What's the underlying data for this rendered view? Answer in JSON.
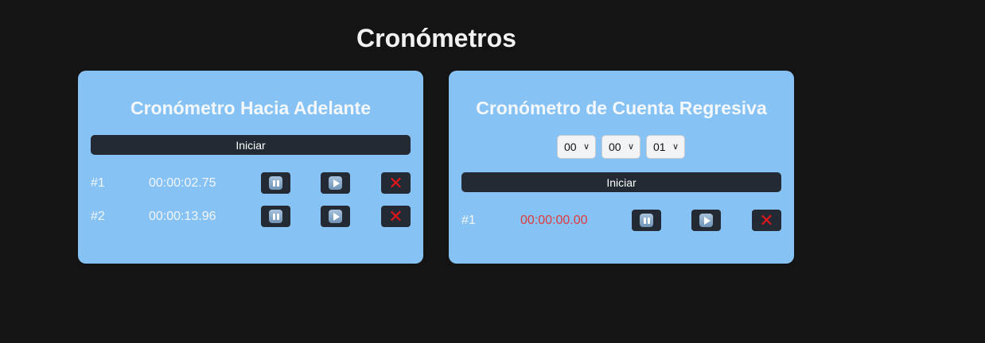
{
  "page_title": "Cronómetros",
  "forward": {
    "title": "Cronómetro Hacia Adelante",
    "start_label": "Iniciar",
    "rows": [
      {
        "id": "#1",
        "time": "00:00:02.75"
      },
      {
        "id": "#2",
        "time": "00:00:13.96"
      }
    ]
  },
  "countdown": {
    "title": "Cronómetro de Cuenta Regresiva",
    "selects": {
      "hours": "00",
      "minutes": "00",
      "seconds": "01"
    },
    "start_label": "Iniciar",
    "rows": [
      {
        "id": "#1",
        "time": "00:00:00.00"
      }
    ]
  },
  "icons": {
    "pause": "pause-button-icon",
    "play": "play-button-icon",
    "delete": "cross-mark-icon",
    "dropdown": "chevron-down-icon"
  },
  "colors": {
    "background": "#141414",
    "panel": "#86c2f3",
    "button": "#232a33",
    "expired_time": "#e03a3a",
    "delete_mark": "#e0161c"
  }
}
